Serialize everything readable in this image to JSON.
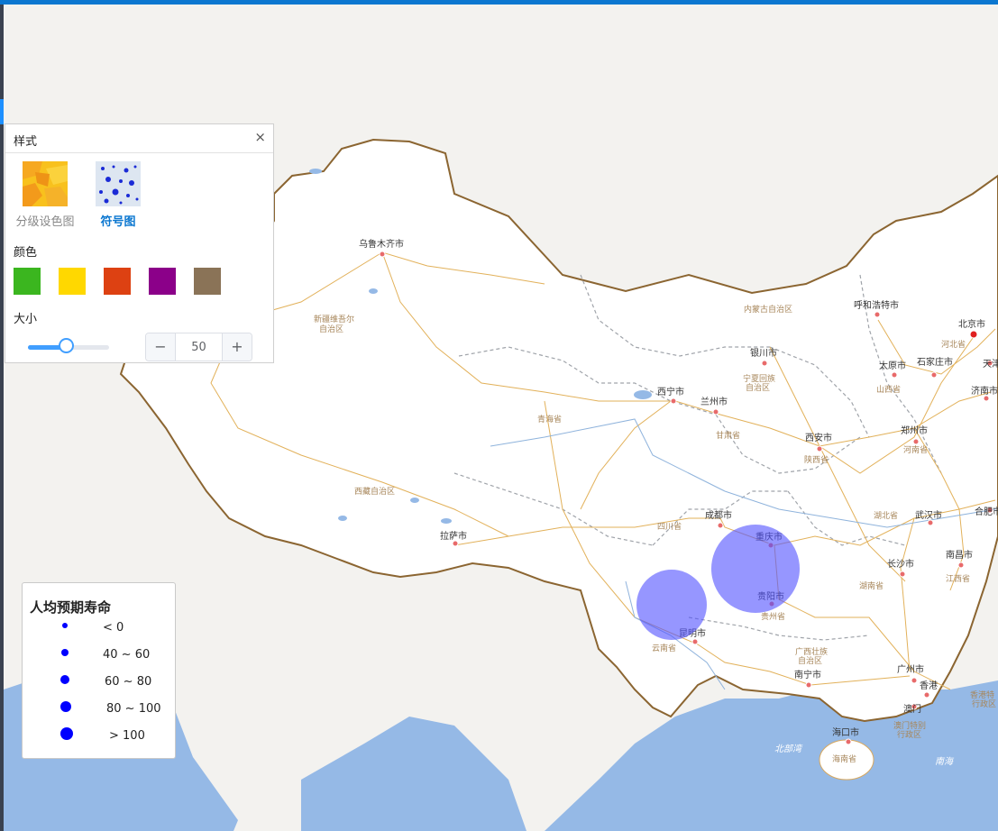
{
  "map": {
    "cities": [
      {
        "name": "乌鲁木齐市"
      },
      {
        "name": "银川市"
      },
      {
        "name": "呼和浩特市"
      },
      {
        "name": "北京市"
      },
      {
        "name": "天津市"
      },
      {
        "name": "太原市"
      },
      {
        "name": "石家庄市"
      },
      {
        "name": "济南市"
      },
      {
        "name": "西宁市"
      },
      {
        "name": "兰州市"
      },
      {
        "name": "西安市"
      },
      {
        "name": "郑州市"
      },
      {
        "name": "合肥市"
      },
      {
        "name": "成都市"
      },
      {
        "name": "重庆市"
      },
      {
        "name": "武汉市"
      },
      {
        "name": "南昌市"
      },
      {
        "name": "长沙市"
      },
      {
        "name": "贵阳市"
      },
      {
        "name": "昆明市"
      },
      {
        "name": "南宁市"
      },
      {
        "name": "广州市"
      },
      {
        "name": "香港"
      },
      {
        "name": "澳门"
      },
      {
        "name": "海口市"
      },
      {
        "name": "拉萨市"
      }
    ],
    "regions": [
      {
        "name": "新疆维吾尔自治区"
      },
      {
        "name": "内蒙古自治区"
      },
      {
        "name": "宁夏回族自治区"
      },
      {
        "name": "青海省"
      },
      {
        "name": "甘肃省"
      },
      {
        "name": "陕西省"
      },
      {
        "name": "山西省"
      },
      {
        "name": "河北省"
      },
      {
        "name": "北京市"
      },
      {
        "name": "河南省"
      },
      {
        "name": "西藏自治区"
      },
      {
        "name": "四川省"
      },
      {
        "name": "湖北省"
      },
      {
        "name": "湖南省"
      },
      {
        "name": "江西省"
      },
      {
        "name": "贵州省"
      },
      {
        "name": "云南省"
      },
      {
        "name": "广西壮族自治区"
      },
      {
        "name": "海南省"
      },
      {
        "name": "澳门特别行政区"
      },
      {
        "name": "香港特别行政区"
      }
    ],
    "seas": [
      {
        "name": "北部湾"
      },
      {
        "name": "南海"
      }
    ],
    "symbol_color": "#5050ff"
  },
  "style_panel": {
    "title": "样式",
    "close_icon": "×",
    "map_types": [
      {
        "label": "分级设色图",
        "icon": "graded-color-thumbnail",
        "selected": false
      },
      {
        "label": "符号图",
        "icon": "symbol-map-thumbnail",
        "selected": true
      }
    ],
    "color_heading": "颜色",
    "colors": [
      "#3bb61f",
      "#ffd800",
      "#dd4112",
      "#8b0089",
      "#8a7357"
    ],
    "size_heading": "大小",
    "size_value": "50",
    "size_slider_fraction": 0.5,
    "minus_label": "−",
    "plus_label": "+"
  },
  "legend": {
    "title": "人均预期寿命",
    "symbol_color": "#0000ff",
    "items": [
      {
        "label": "< 0"
      },
      {
        "label": "40 ~ 60"
      },
      {
        "label": "60 ~ 80"
      },
      {
        "label": "80 ~ 100"
      },
      {
        "label": "> 100"
      }
    ]
  }
}
